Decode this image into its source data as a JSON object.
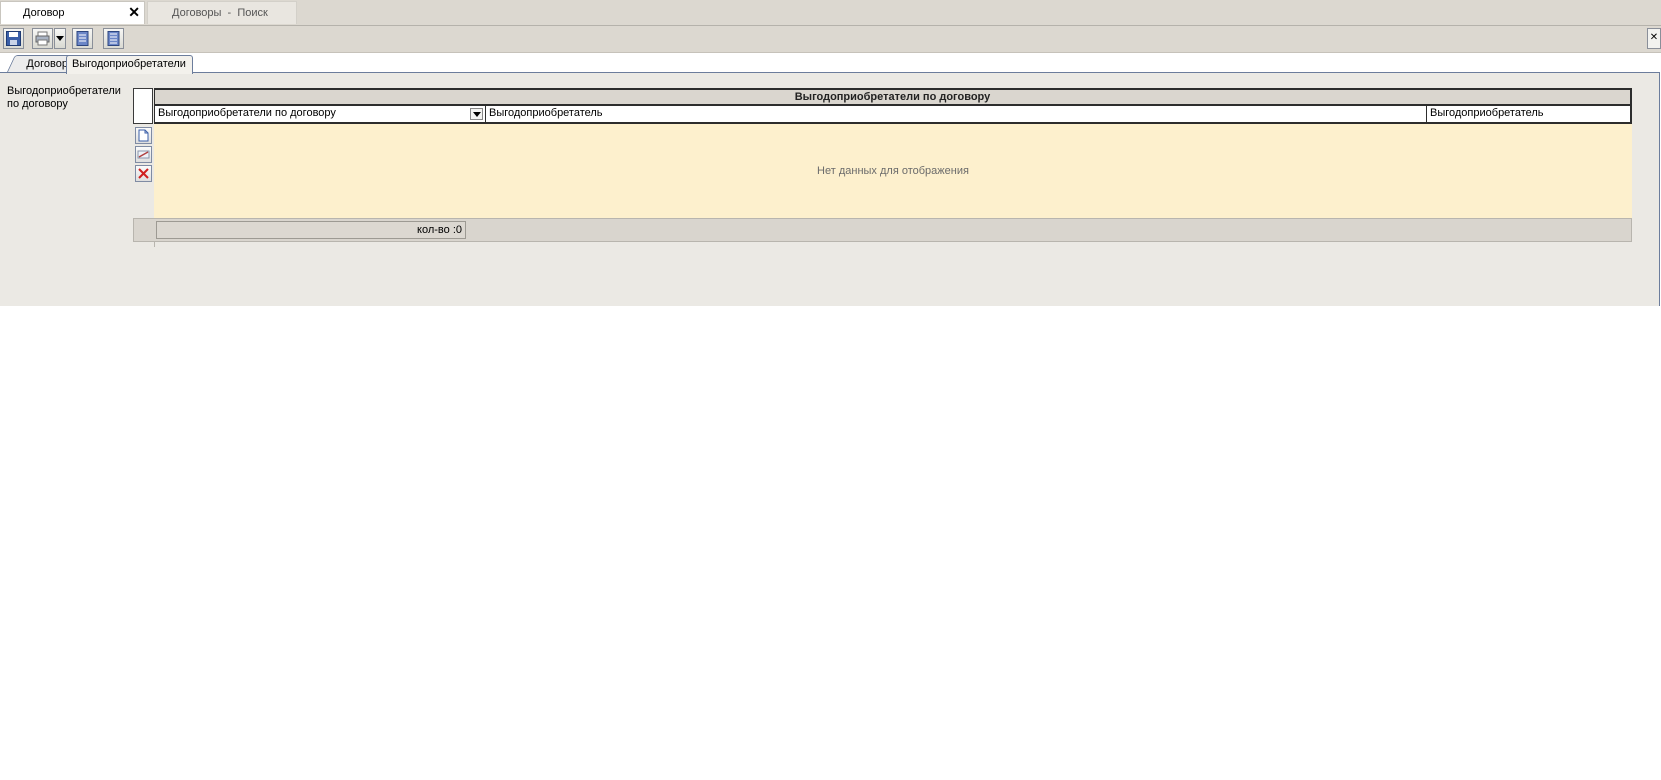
{
  "doc_tabs": [
    {
      "label": "Договор",
      "close": "✕"
    },
    {
      "label": "Договоры  -  Поиск"
    }
  ],
  "toolbar": {
    "buttons": [
      "save-icon",
      "print-icon",
      "document-list-icon",
      "document-list-alt-icon"
    ],
    "right_button": "✕"
  },
  "inner_tabs": [
    "Договор",
    "Выгодоприобретатели"
  ],
  "side_label": "Выгодоприобретатели по договору",
  "grid": {
    "title": "Выгодоприобретатели по договору",
    "columns": [
      "Выгодоприобретатели по договору",
      "Выгодоприобретатель",
      "Выгодоприобретатель"
    ],
    "empty_message": "Нет данных для отображения",
    "footer_count": "кол-во :0",
    "row_buttons": [
      "add-icon",
      "edit-icon",
      "delete-icon"
    ]
  },
  "colors": {
    "chrome": "#dcd8d0",
    "panel": "#ebe9e4",
    "grid_body": "#fdf0cd",
    "tab_border": "#6c7d9c"
  }
}
